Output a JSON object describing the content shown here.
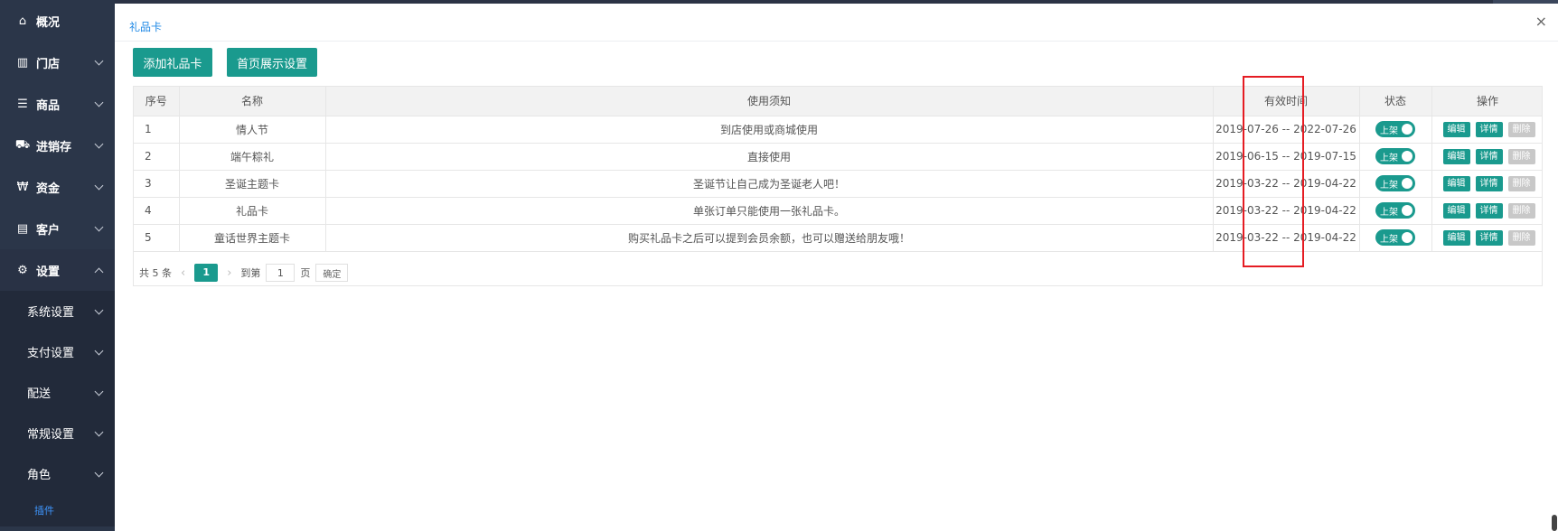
{
  "sidebar": {
    "items": [
      {
        "label": "概况",
        "icon": "home-icon",
        "glyph": "⌂"
      },
      {
        "label": "门店",
        "icon": "store-icon",
        "glyph": "▥"
      },
      {
        "label": "商品",
        "icon": "list-icon",
        "glyph": "☰"
      },
      {
        "label": "进销存",
        "icon": "truck-icon",
        "glyph": "⛟"
      },
      {
        "label": "资金",
        "icon": "won-icon",
        "glyph": "₩"
      },
      {
        "label": "客户",
        "icon": "id-card-icon",
        "glyph": "▤"
      },
      {
        "label": "设置",
        "icon": "gear-icon",
        "glyph": "⚙"
      }
    ],
    "sub_items": [
      "系统设置",
      "支付设置",
      "配送",
      "常规设置",
      "角色"
    ],
    "active_sub": "插件"
  },
  "panel": {
    "title": "礼品卡",
    "close_glyph": "×"
  },
  "toolbar": {
    "add_label": "添加礼品卡",
    "home_label": "首页展示设置"
  },
  "table": {
    "headers": [
      "序号",
      "名称",
      "使用须知",
      "有效时间",
      "状态",
      "操作"
    ],
    "rows": [
      {
        "no": "1",
        "name": "情人节",
        "notice": "到店使用或商城使用",
        "period": "2019-07-26 -- 2022-07-26"
      },
      {
        "no": "2",
        "name": "端午粽礼",
        "notice": "直接使用",
        "period": "2019-06-15 -- 2019-07-15"
      },
      {
        "no": "3",
        "name": "圣诞主题卡",
        "notice": "圣诞节让自己成为圣诞老人吧！",
        "period": "2019-03-22 -- 2019-04-22"
      },
      {
        "no": "4",
        "name": "礼品卡",
        "notice": "单张订单只能使用一张礼品卡。",
        "period": "2019-03-22 -- 2019-04-22"
      },
      {
        "no": "5",
        "name": "童话世界主题卡",
        "notice": "购买礼品卡之后可以提到会员余额，也可以赠送给朋友哦！",
        "period": "2019-03-22 -- 2019-04-22"
      }
    ],
    "status_label": "上架",
    "op_edit": "编辑",
    "op_detail": "详情",
    "op_delete": "删除"
  },
  "pager": {
    "total": "共 5 条",
    "current": "1",
    "goto_label": "到第",
    "page_value": "1",
    "page_suffix": "页",
    "confirm": "确定"
  },
  "colors": {
    "accent": "#1a9a8e",
    "sidebar": "#2b3649",
    "link": "#1e88e5",
    "highlight": "#e51c23"
  }
}
